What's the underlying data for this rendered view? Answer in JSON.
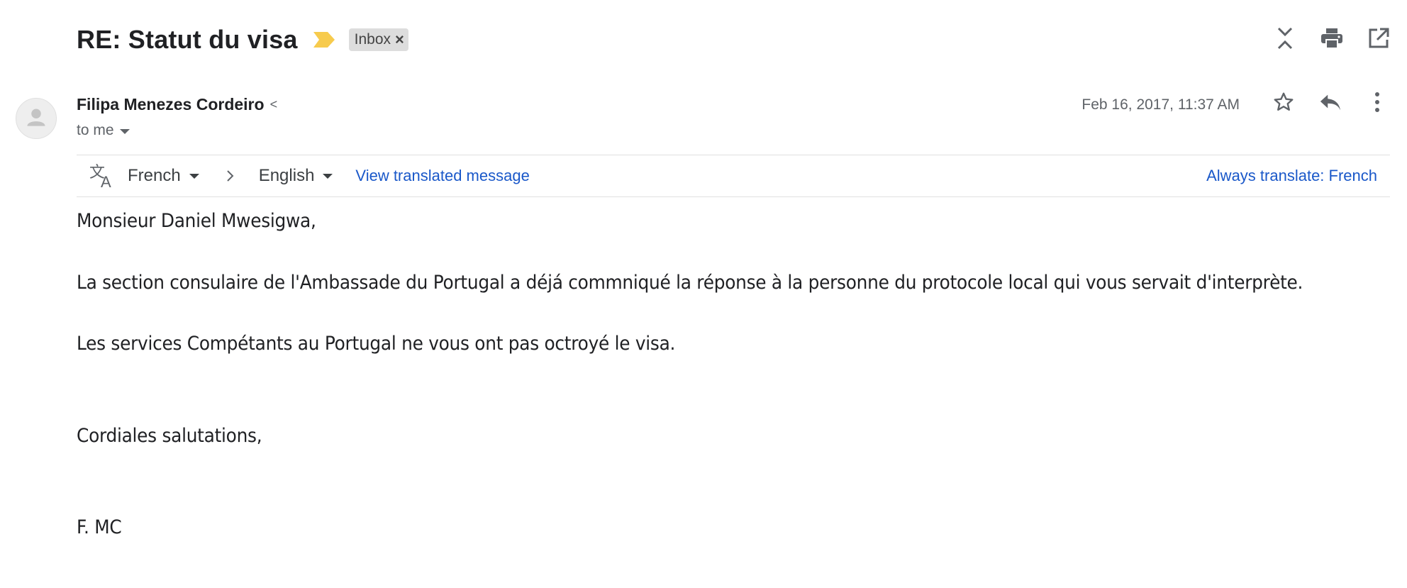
{
  "subject": "RE: Statut du visa",
  "label": {
    "text": "Inbox"
  },
  "sender": {
    "name": "Filipa Menezes Cordeiro",
    "caret": "<",
    "recipient_text": "to me"
  },
  "date": "Feb 16, 2017, 11:37 AM",
  "translate_bar": {
    "from_language": "French",
    "to_language": "English",
    "view_translated": "View translated message",
    "always_translate": "Always translate: French"
  },
  "body": {
    "greeting": "Monsieur Daniel Mwesigwa,",
    "paragraph1": "La section consulaire de l'Ambassade du Portugal a déjá commniqué la réponse à la personne du protocole local qui vous servait d'interprète.",
    "paragraph2": "Les services Compétants au Portugal ne vous ont pas octroyé le visa.",
    "closing": "Cordiales salutations,",
    "signature": "F. MC"
  },
  "colors": {
    "link": "#1a58c9",
    "importance_marker": "#f7cb4d",
    "label_chip_bg": "#dddddd"
  }
}
